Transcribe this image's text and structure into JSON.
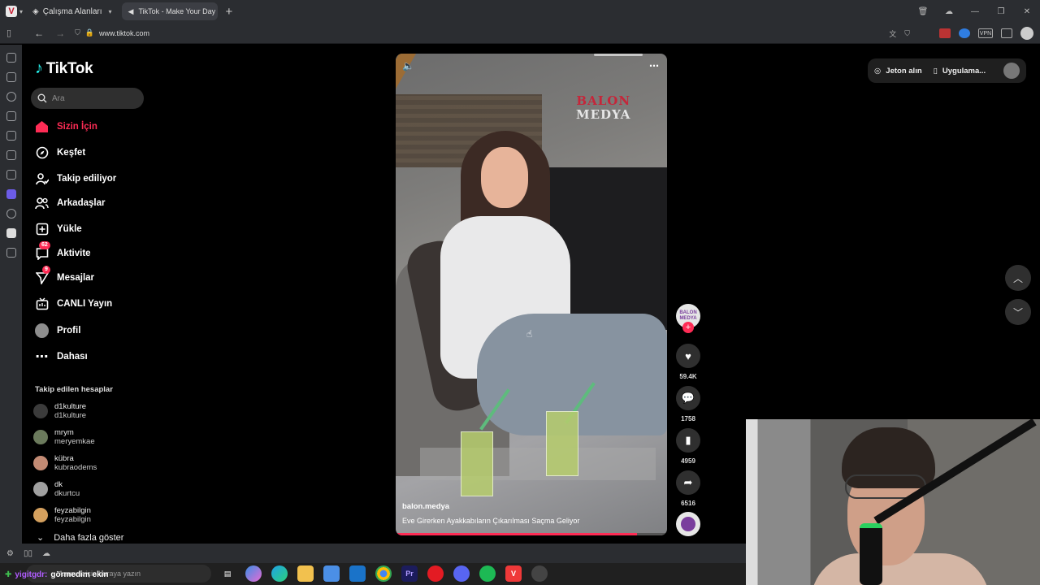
{
  "browser": {
    "workspace_label": "Çalışma Alanları",
    "tab_title": "TikTok - Make Your Day",
    "url": "www.tiktok.com"
  },
  "sidebar": {
    "logo": "TikTok",
    "search_placeholder": "Ara",
    "nav": [
      {
        "label": "Sizin İçin",
        "icon": "home-icon",
        "active": true
      },
      {
        "label": "Keşfet",
        "icon": "compass-icon"
      },
      {
        "label": "Takip ediliyor",
        "icon": "following-icon"
      },
      {
        "label": "Arkadaşlar",
        "icon": "friends-icon"
      },
      {
        "label": "Yükle",
        "icon": "upload-icon"
      },
      {
        "label": "Aktivite",
        "icon": "activity-icon",
        "badge": "62"
      },
      {
        "label": "Mesajlar",
        "icon": "messages-icon",
        "badge": "9"
      },
      {
        "label": "CANLI Yayın",
        "icon": "live-icon"
      },
      {
        "label": "Profil",
        "icon": "profile-avatar"
      },
      {
        "label": "Dahası",
        "icon": "more-dots-icon"
      }
    ],
    "following_title": "Takip edilen hesaplar",
    "following": [
      {
        "name": "d1kulture",
        "handle": "d1kulture"
      },
      {
        "name": "mrym",
        "handle": "meryemkae"
      },
      {
        "name": "kübra",
        "handle": "kubraodems"
      },
      {
        "name": "dk",
        "handle": "dkurtcu"
      },
      {
        "name": "feyzabilgin",
        "handle": "feyzabilgin"
      }
    ],
    "show_more": "Daha fazla göster"
  },
  "video": {
    "brand_line1": "BALON",
    "brand_line2": "MEDYA",
    "author": "balon.medya",
    "description": "Eve Girerken Ayakkabıların Çıkarılması Saçma Geliyor",
    "progress": 0.89
  },
  "actions": {
    "avatar_text": "BALON MEDYA",
    "likes": "59.4K",
    "comments": "1758",
    "saves": "4959",
    "shares": "6516"
  },
  "topright": {
    "coins": "Jeton alın",
    "app": "Uygulama..."
  },
  "taskbar": {
    "search_placeholder": "Aramak için buraya yazın"
  },
  "chat": {
    "user": "yigitgdr:",
    "message": "görmedim ekin"
  },
  "colors": {
    "accent": "#fe2c55",
    "chrome": "#2b2d31"
  }
}
